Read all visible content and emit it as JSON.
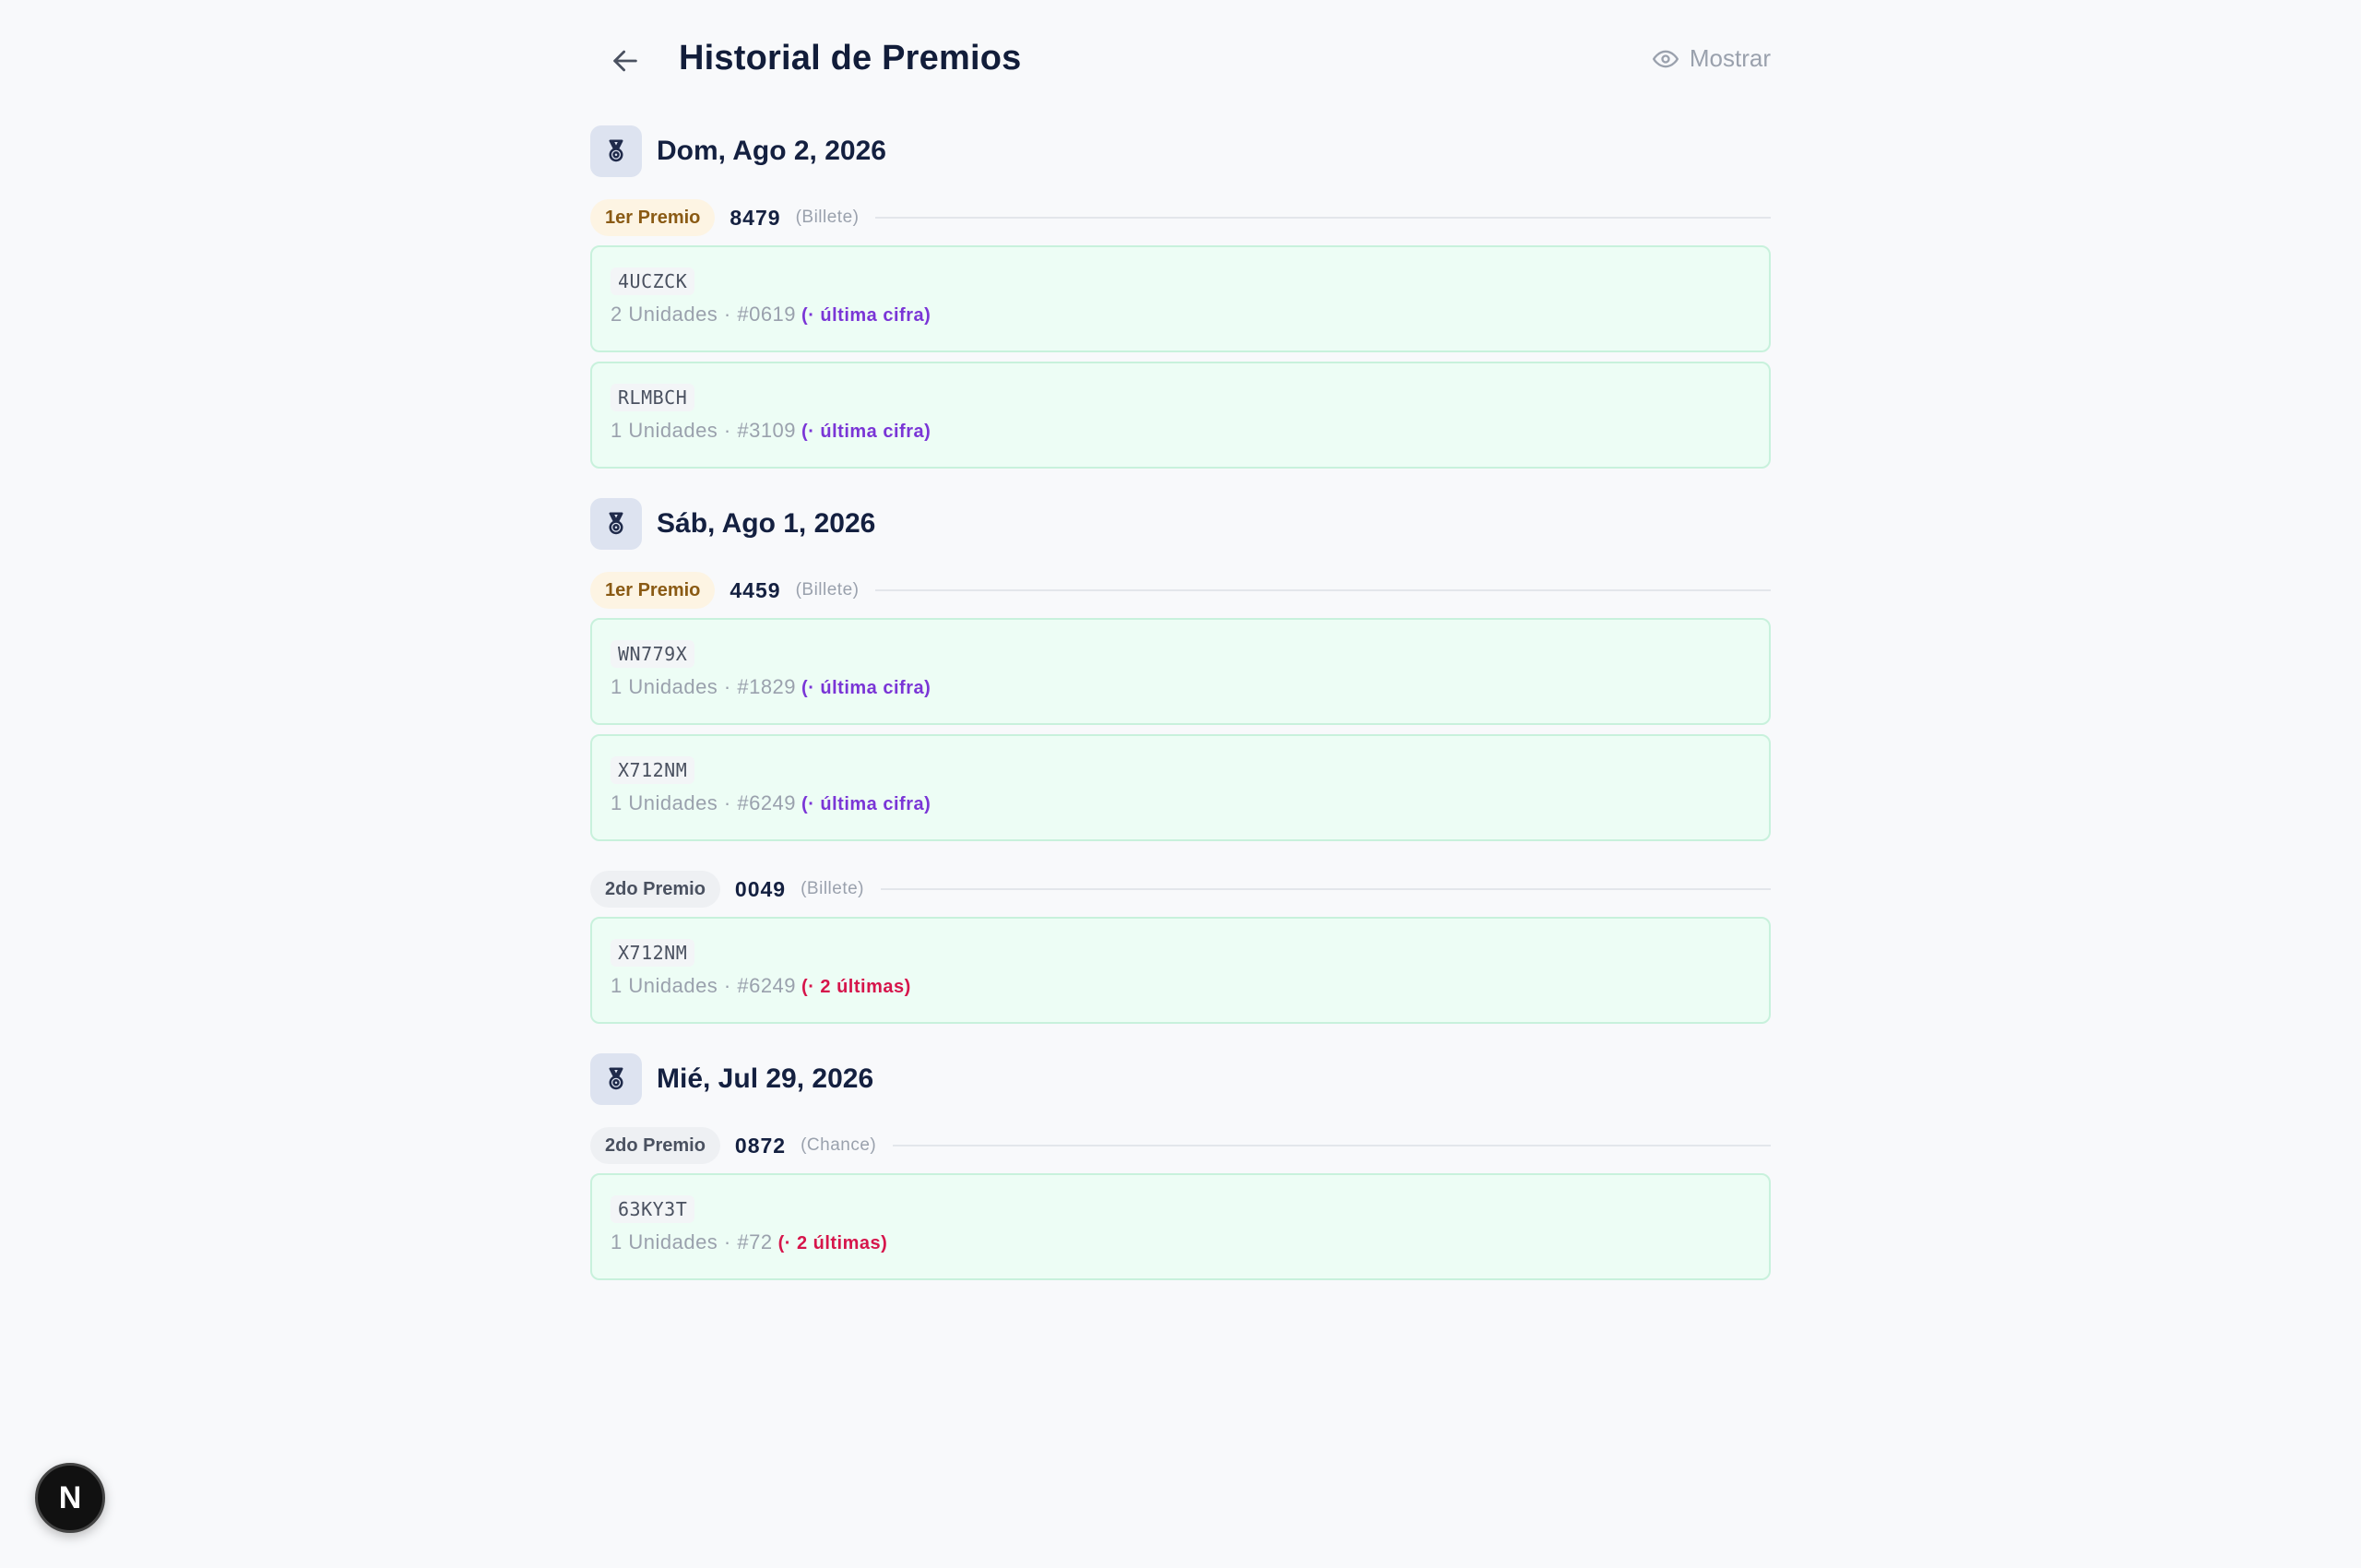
{
  "header": {
    "title": "Historial de Premios",
    "toggle_label": "Mostrar"
  },
  "days": [
    {
      "date": "Dom, Ago 2, 2026",
      "prizes": [
        {
          "badge": "1er Premio",
          "rank": "first",
          "number": "8479",
          "kind": "(Billete)",
          "tickets": [
            {
              "code": "4UCZCK",
              "meta": "2 Unidades · #0619",
              "match": "(· última cifra)",
              "match_color": "purple"
            },
            {
              "code": "RLMBCH",
              "meta": "1 Unidades · #3109",
              "match": "(· última cifra)",
              "match_color": "purple"
            }
          ]
        }
      ]
    },
    {
      "date": "Sáb, Ago 1, 2026",
      "prizes": [
        {
          "badge": "1er Premio",
          "rank": "first",
          "number": "4459",
          "kind": "(Billete)",
          "tickets": [
            {
              "code": "WN779X",
              "meta": "1 Unidades · #1829",
              "match": "(· última cifra)",
              "match_color": "purple"
            },
            {
              "code": "X712NM",
              "meta": "1 Unidades · #6249",
              "match": "(· última cifra)",
              "match_color": "purple"
            }
          ]
        },
        {
          "badge": "2do Premio",
          "rank": "second",
          "number": "0049",
          "kind": "(Billete)",
          "tickets": [
            {
              "code": "X712NM",
              "meta": "1 Unidades · #6249",
              "match": "(· 2 últimas)",
              "match_color": "red"
            }
          ]
        }
      ]
    },
    {
      "date": "Mié, Jul 29, 2026",
      "prizes": [
        {
          "badge": "2do Premio",
          "rank": "second",
          "number": "0872",
          "kind": "(Chance)",
          "tickets": [
            {
              "code": "63KY3T",
              "meta": "1 Unidades · #72",
              "match": "(· 2 últimas)",
              "match_color": "red"
            }
          ]
        }
      ]
    }
  ],
  "floating_badge": {
    "letter": "N"
  },
  "colors": {
    "background": "#f8f9fb",
    "card_bg": "#edfdf5",
    "card_border": "#c8f1dc",
    "purple": "#7a35d6",
    "red": "#d6154b",
    "first_badge_bg": "#fdf4e3",
    "second_badge_bg": "#eef0f3"
  },
  "icons": {
    "back": "arrow-left-icon",
    "toggle": "eye-icon",
    "day": "medal-icon"
  }
}
